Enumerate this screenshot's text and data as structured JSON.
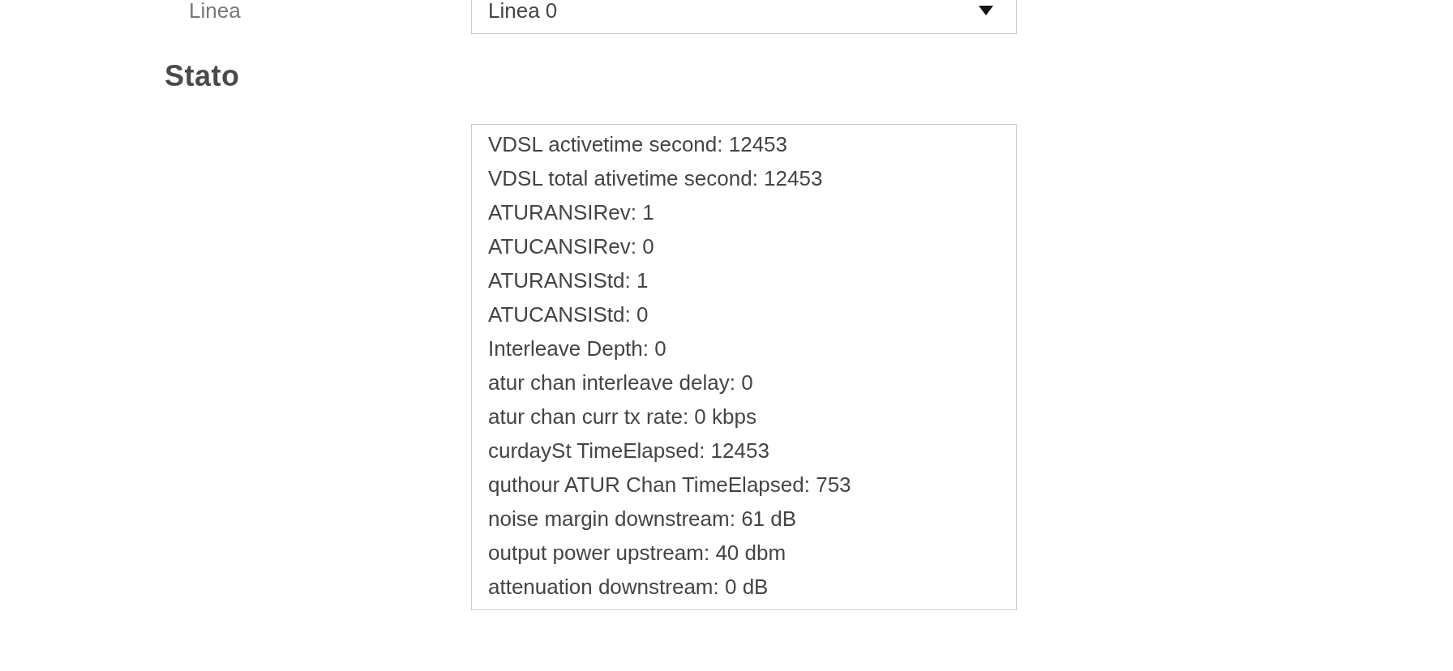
{
  "line_field": {
    "label": "Linea",
    "value": "Linea 0"
  },
  "status": {
    "heading": "Stato",
    "lines": [
      "VDSL activetime second: 12453",
      "VDSL total ativetime second: 12453",
      "ATURANSIRev: 1",
      "ATUCANSIRev: 0",
      "ATURANSIStd: 1",
      "ATUCANSIStd: 0",
      "Interleave Depth: 0",
      "atur chan interleave delay: 0",
      "atur chan curr tx rate: 0 kbps",
      "curdaySt TimeElapsed: 12453",
      "quthour ATUR Chan TimeElapsed: 753",
      "noise margin downstream: 61 dB",
      "output power upstream: 40 dbm",
      "attenuation downstream: 0 dB"
    ]
  }
}
